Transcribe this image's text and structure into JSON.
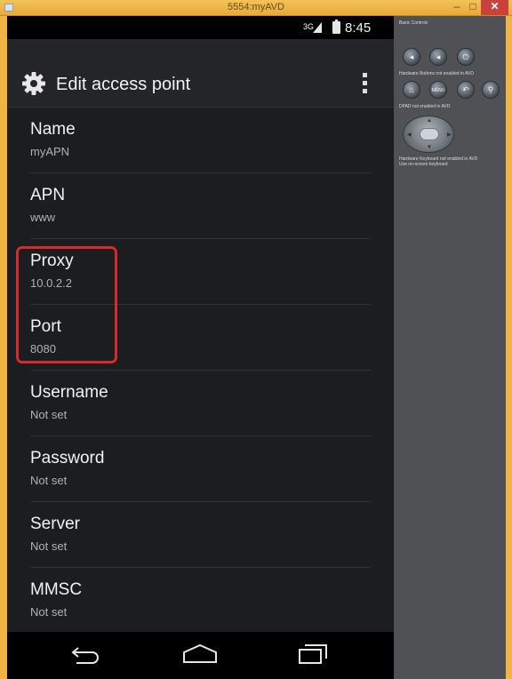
{
  "window": {
    "title": "5554:myAVD",
    "minimize": "–",
    "maximize": "□",
    "close": "✕"
  },
  "statusbar": {
    "network": "3G",
    "time": "8:45"
  },
  "actionbar": {
    "title": "Edit access point",
    "icon": "settings-gear-icon"
  },
  "prefs": [
    {
      "title": "Name",
      "summary": "myAPN"
    },
    {
      "title": "APN",
      "summary": "www"
    },
    {
      "title": "Proxy",
      "summary": "10.0.2.2"
    },
    {
      "title": "Port",
      "summary": "8080"
    },
    {
      "title": "Username",
      "summary": "Not set"
    },
    {
      "title": "Password",
      "summary": "Not set"
    },
    {
      "title": "Server",
      "summary": "Not set"
    },
    {
      "title": "MMSC",
      "summary": "Not set"
    }
  ],
  "highlight_color": "#d42b2b",
  "side_panel": {
    "basic_controls": "Basic Controls",
    "hardware_buttons": "Hardware Buttons not enabled in AVD",
    "dpad": "DPAD not enabled in AVD",
    "keyboard_line1": "Hardware Keyboard not enabled in AVD",
    "keyboard_line2": "Use on-screen keyboard",
    "menu_label": "MENU"
  }
}
